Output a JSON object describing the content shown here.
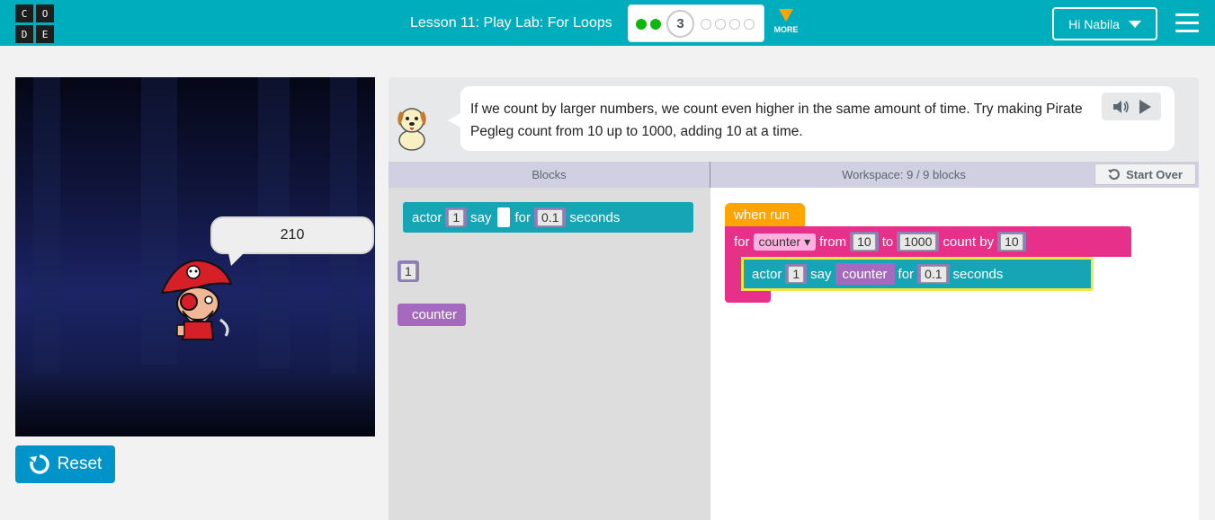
{
  "header": {
    "logo_letters": [
      "C",
      "O",
      "D",
      "E"
    ],
    "lesson_title": "Lesson 11: Play Lab: For Loops",
    "current_level": "3",
    "more_label": "MORE",
    "user_greeting": "Hi Nabila"
  },
  "game": {
    "speech_text": "210",
    "reset_label": "Reset"
  },
  "instructions": {
    "text": "If we count by larger numbers, we count even higher in the same amount of time. Try making Pirate Pegleg count from 10 up to 1000, adding 10 at a time."
  },
  "workspace_header": {
    "blocks_label": "Blocks",
    "workspace_label": "Workspace: 9 / 9 blocks",
    "start_over_label": "Start Over"
  },
  "toolbox": {
    "say_block": {
      "actor": "actor",
      "actor_num": "1",
      "say": "say",
      "for": "for",
      "seconds_val": "0.1",
      "seconds": "seconds"
    },
    "number_block": "1",
    "variable_block": "counter"
  },
  "program": {
    "when_run": "when run",
    "for_label": "for",
    "variable": "counter",
    "from_label": "from",
    "from_val": "10",
    "to_label": "to",
    "to_val": "1000",
    "by_label": "count by",
    "by_val": "10",
    "say_block": {
      "actor": "actor",
      "actor_num": "1",
      "say": "say",
      "say_var": "counter",
      "for": "for",
      "seconds_val": "0.1",
      "seconds": "seconds"
    }
  },
  "colors": {
    "header": "#00adbc",
    "event_block": "#ffa400",
    "loop_block": "#e6308a",
    "action_block": "#16a5b5",
    "reset_button": "#0094ca"
  }
}
